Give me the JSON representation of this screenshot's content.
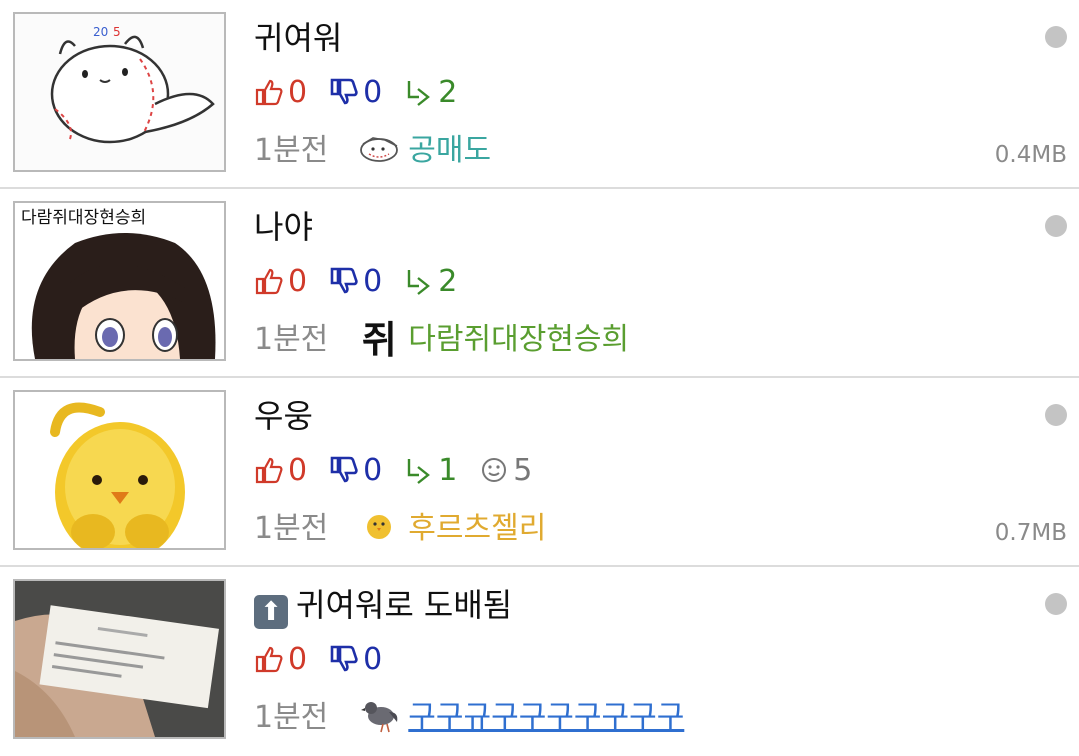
{
  "posts": [
    {
      "title": "귀여워",
      "likes": "0",
      "dislikes": "0",
      "replies": "2",
      "views": null,
      "time": "1분전",
      "author": "공매도",
      "author_color": "#3aa6a0",
      "size": "0.4MB",
      "thumb_icon": "baseball-seal-cartoon"
    },
    {
      "title": "나야",
      "likes": "0",
      "dislikes": "0",
      "replies": "2",
      "views": null,
      "time": "1분전",
      "badge_text": "쥐",
      "author": "다람쥐대장현승희",
      "author_color": "#5a9e30",
      "size": null,
      "thumb_text": "다람쥐대장현승희",
      "thumb_icon": "anime-girl-face"
    },
    {
      "title": "우웅",
      "likes": "0",
      "dislikes": "0",
      "replies": "1",
      "views": "5",
      "time": "1분전",
      "author": "후르츠젤리",
      "author_color": "#e0aa30",
      "size": "0.7MB",
      "thumb_icon": "yellow-chick-jelly"
    },
    {
      "title": "귀여워로 도배됨",
      "title_prefix_icon": "up-arrow-icon",
      "likes": "0",
      "dislikes": "0",
      "replies": null,
      "views": null,
      "time": "1분전",
      "author": "구구규구구구구구구구",
      "author_color": "#2f6fd0",
      "size": null,
      "thumb_icon": "hand-holding-card-photo"
    }
  ],
  "colors": {
    "like": "#d03a2a",
    "dislike": "#1e2fa8",
    "reply": "#3a8a2a",
    "muted": "#8a8a8a",
    "separator": "#dcdcdc"
  }
}
